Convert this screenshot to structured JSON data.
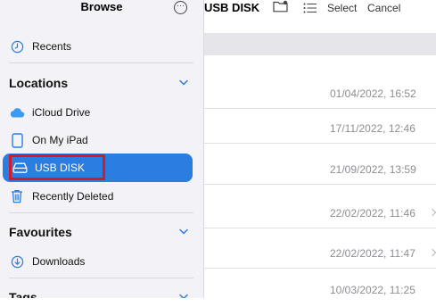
{
  "sidebar": {
    "title": "Browse",
    "recents_label": "Recents",
    "sections": {
      "locations": "Locations",
      "favourites": "Favourites",
      "tags": "Tags"
    },
    "locations": [
      {
        "label": "iCloud Drive",
        "icon": "icloud-icon"
      },
      {
        "label": "On My iPad",
        "icon": "ipad-icon"
      },
      {
        "label": "USB DISK",
        "icon": "drive-icon",
        "selected": true
      },
      {
        "label": "Recently Deleted",
        "icon": "trash-icon"
      }
    ],
    "favourites": [
      {
        "label": "Downloads",
        "icon": "download-icon"
      }
    ],
    "accent": "#2a7de1",
    "highlight_color": "#d11a2a"
  },
  "main": {
    "location_title": "USB DISK",
    "select_label": "Select",
    "cancel_label": "Cancel",
    "rows": [
      {
        "date": "01/04/2022, 16:52",
        "disclosure": false
      },
      {
        "date": "17/11/2022, 12:46",
        "disclosure": false
      },
      {
        "date": "21/09/2022, 13:59",
        "disclosure": false
      },
      {
        "date": "22/02/2022, 11:46",
        "disclosure": true
      },
      {
        "date": "22/02/2022, 11:47",
        "disclosure": true
      },
      {
        "date": "10/03/2022, 11:25",
        "disclosure": false
      }
    ]
  }
}
